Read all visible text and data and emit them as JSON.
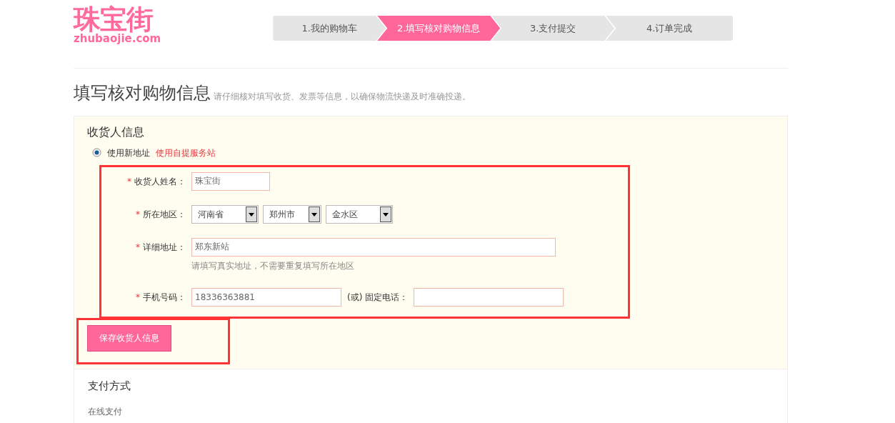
{
  "logo": {
    "name": "珠宝街",
    "domain": "zhubaojie.com"
  },
  "steps": [
    {
      "label": "1.我的购物车",
      "selected": false
    },
    {
      "label": "2.填写核对购物信息",
      "selected": true
    },
    {
      "label": "3.支付提交",
      "selected": false
    },
    {
      "label": "4.订单完成",
      "selected": false
    }
  ],
  "heading": {
    "title": "填写核对购物信息",
    "subtitle": "请仔细核对填写收货、发票等信息，以确保物流快递及时准确投递。"
  },
  "receiver": {
    "title": "收货人信息",
    "address_options": [
      {
        "kind": "radio",
        "label": "使用新地址",
        "selected": true
      },
      {
        "kind": "link",
        "label": "使用自提服务站"
      }
    ],
    "required_mark": "*",
    "fields": [
      {
        "kind": "text",
        "label": "收货人姓名：",
        "required": true,
        "value": "珠宝街"
      },
      {
        "kind": "selects",
        "label": "所在地区：",
        "required": true,
        "values": [
          "河南省",
          "郑州市",
          "金水区"
        ]
      },
      {
        "kind": "wide",
        "label": "详细地址：",
        "required": true,
        "value": "郑东新站",
        "hint": "请填写真实地址，不需要重复填写所在地区"
      },
      {
        "kind": "phone",
        "label": "手机号码：",
        "required": true,
        "value": "18336363881",
        "alt_label": "(或) 固定电话："
      }
    ],
    "save_button": "保存收货人信息"
  },
  "payment": {
    "title": "支付方式",
    "method": "在线支付"
  }
}
